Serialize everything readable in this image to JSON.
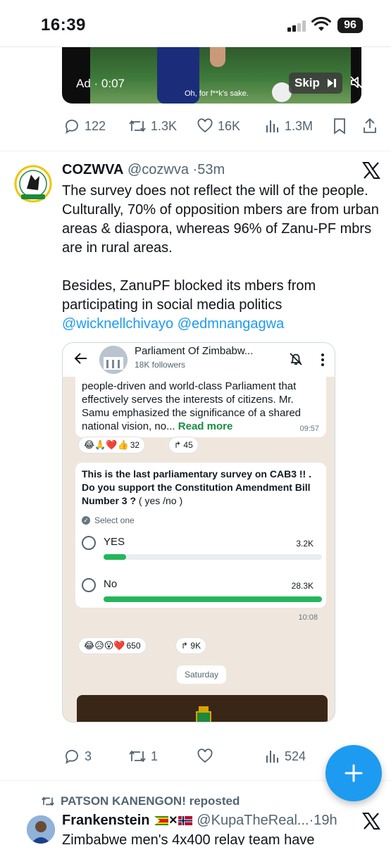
{
  "status_bar": {
    "time": "16:39",
    "battery": "96"
  },
  "video_ad": {
    "ad_label": "Ad · 0:07",
    "caption": "Oh, for f**k's sake.",
    "skip_label": "Skip"
  },
  "ad_actions": {
    "replies": "122",
    "reposts": "1.3K",
    "likes": "16K",
    "views": "1.3M"
  },
  "tweet": {
    "name": "COZWVA",
    "handle": "@cozwva",
    "time": "·53m",
    "paragraph1": "The survey does not reflect the will of the people. Culturally, 70% of opposition mbers are from urban areas & diaspora, whereas 96% of Zanu-PF mbrs are in rural areas.",
    "paragraph2": "Besides, ZanuPF blocked its mbers from participating in social media politics",
    "mentions": "@wicknellchivayo @edmnangagwa",
    "actions": {
      "replies": "3",
      "reposts": "1",
      "likes": "",
      "views": "524"
    }
  },
  "screenshot": {
    "channel_title": "Parliament Of Zimbabw...",
    "followers": "18K followers",
    "message1": "people-driven and world-class Parliament that effectively serves the interests of citizens. Mr. Samu emphasized the significance of a shared national vision, no...",
    "read_more": "Read more",
    "message1_time": "09:57",
    "reactions1": {
      "emojis": "😂🙏❤️👍",
      "count": "32",
      "forwards": "45"
    },
    "poll": {
      "question_prefix": "This is the last parliamentary survey on CAB3 !! . ",
      "question_bold": "Do you support the Constitution Amendment Bill Number 3 ? ",
      "question_suffix": "( yes /no )",
      "select_label": "Select one",
      "options": [
        {
          "label": "YES",
          "count": "3.2K",
          "fraction": 0.102
        },
        {
          "label": "No",
          "count": "28.3K",
          "fraction": 1.0
        }
      ],
      "time": "10:08"
    },
    "reactions2": {
      "emojis": "😂😥😮❤️",
      "count": "650",
      "forwards": "9K"
    },
    "day_label": "Saturday"
  },
  "repost": {
    "reposter_line": "PATSON KANENGON! reposted",
    "name": "Frankenstein",
    "handle": "@KupaTheReal...",
    "time": "·19h",
    "text": "Zimbabwe  men's 4x400 relay team have"
  },
  "colors": {
    "accent": "#1d9bf0",
    "poll_bar": "#25b65a",
    "secondary_text": "#536471"
  }
}
